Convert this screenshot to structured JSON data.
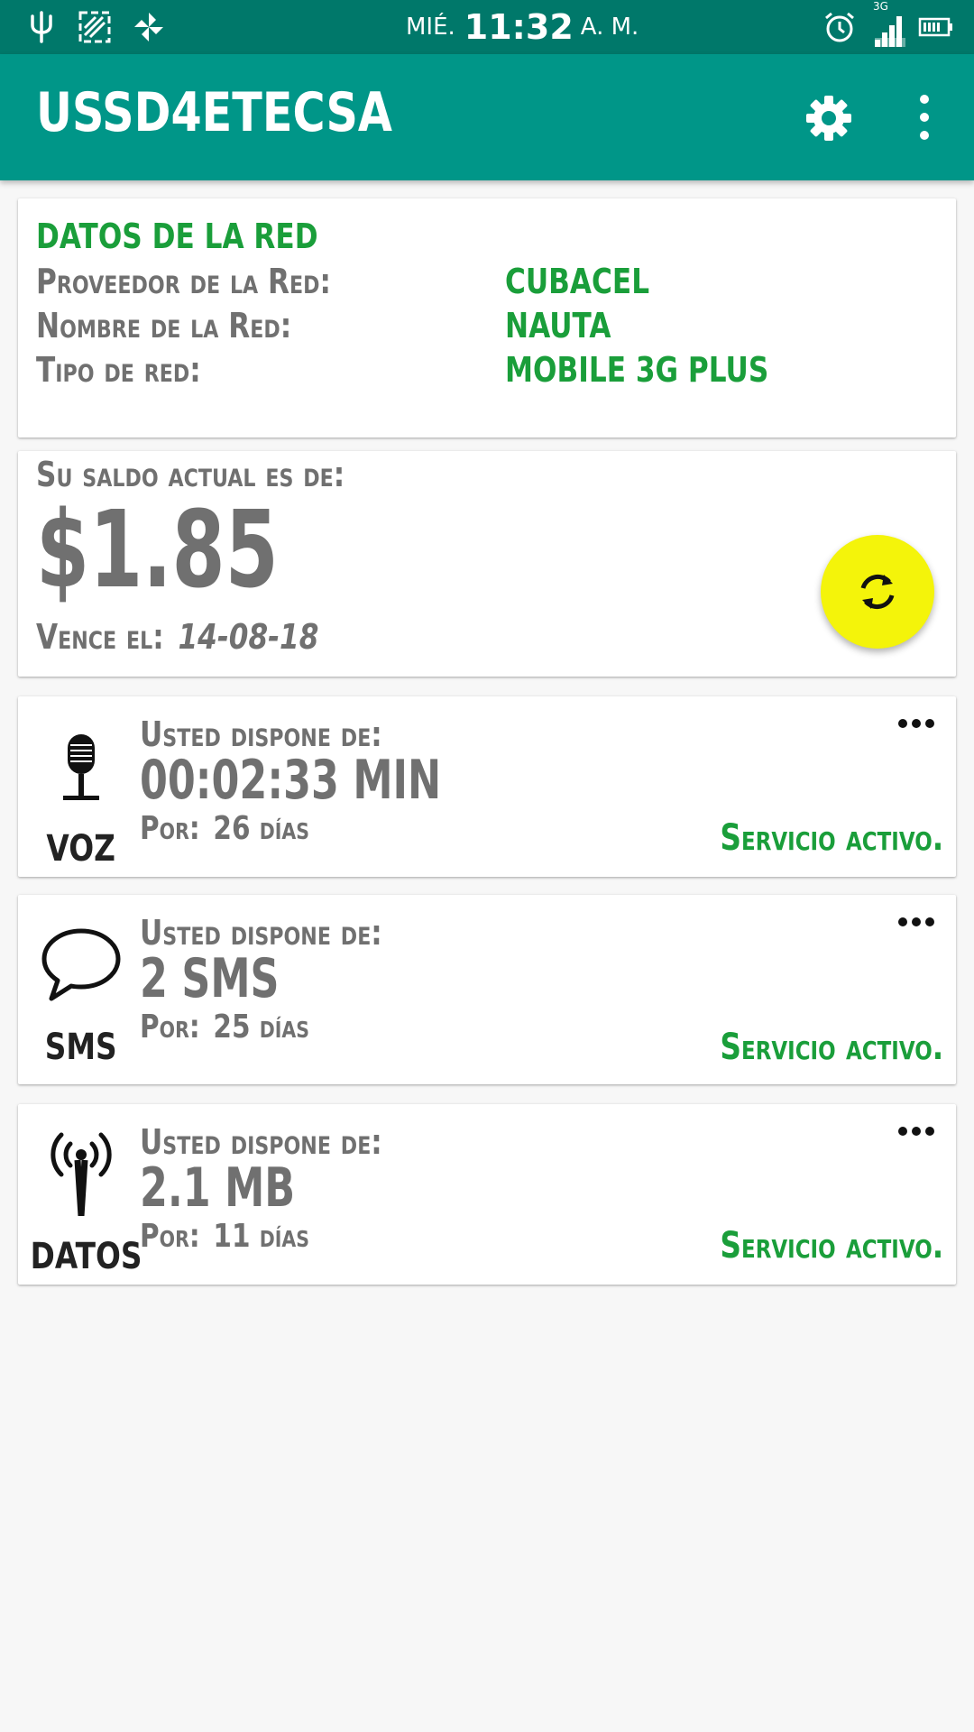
{
  "status_bar": {
    "day": "MIÉ.",
    "time": "11:32",
    "suffix": "A. M.",
    "network_type": "3G",
    "icons": [
      "usb-icon",
      "screenshot-icon",
      "pinwheel-icon",
      "alarm-icon",
      "signal-icon",
      "battery-icon"
    ]
  },
  "app_bar": {
    "title": "USSD4ETECSA",
    "icons": [
      "settings-gear-icon",
      "overflow-menu-icon"
    ],
    "color": "#009688",
    "status_color": "#00786a"
  },
  "network": {
    "heading": "DATOS DE LA RED",
    "provider_label": "Proveedor de la Red:",
    "provider_value": "CUBACEL",
    "name_label": "Nombre de la Red:",
    "name_value": "NAUTA",
    "type_label": "Tipo de red:",
    "type_value": "MOBILE 3G PLUS"
  },
  "balance": {
    "label": "Su saldo actual es de:",
    "amount": "$1.85",
    "expires_label": "Vence el:",
    "expires_date": "14-08-18",
    "refresh_icon": "refresh-icon",
    "fab_color": "#f4f40a"
  },
  "services": {
    "voz": {
      "name": "VOZ",
      "icon": "microphone-icon",
      "pre": "Usted dispone de:",
      "amount": "00:02:33 MIN",
      "period_label": "Por:",
      "period_value": "26 días",
      "status": "Servicio activo."
    },
    "sms": {
      "name": "SMS",
      "icon": "chat-bubble-icon",
      "pre": "Usted dispone de:",
      "amount": "2 SMS",
      "period_label": "Por:",
      "period_value": "25 días",
      "status": "Servicio activo."
    },
    "datos": {
      "name": "DATOS",
      "icon": "antenna-icon",
      "pre": "Usted dispone de:",
      "amount": "2.1 MB",
      "period_label": "Por:",
      "period_value": "11 días",
      "status": "Servicio activo."
    }
  },
  "accent_green": "#1a9e3a"
}
